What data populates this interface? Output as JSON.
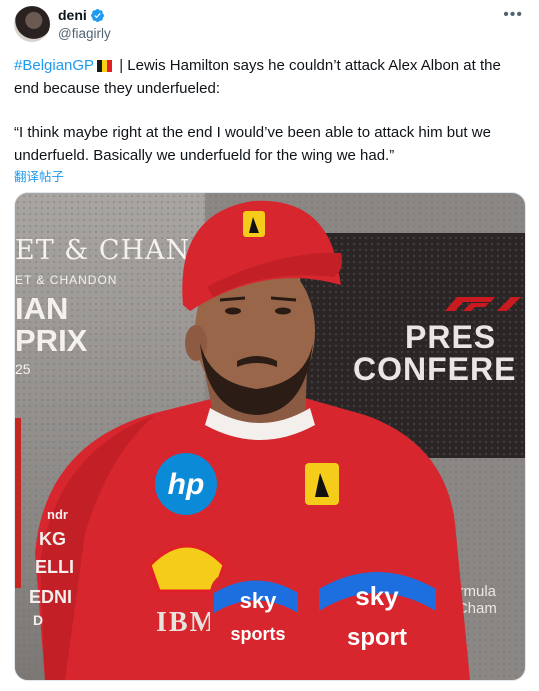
{
  "author": {
    "display_name": "deni",
    "handle": "@fiagirly",
    "verified": true
  },
  "tweet": {
    "hashtag": "#BelgianGP",
    "line1_rest": " | Lewis Hamilton says he couldn’t attack Alex Albon at the end because they underfueled:",
    "quote": "“I think maybe right at the end I would’ve been able to attack him but we underfueld. Basically we underfueld for the wing we had.”",
    "translate_label": "翻译帖子",
    "flag_colors": [
      "#1a1a1a",
      "#f7d117",
      "#e21f26"
    ]
  },
  "media": {
    "backdrop_left": [
      "ET & CHAN",
      "ET & CHANDON",
      "IAN",
      "PRIX",
      "25"
    ],
    "press_conference": [
      "PRES",
      "CONFERE"
    ],
    "backdrop_f1_text": [
      "Formula",
      "ld Cham"
    ],
    "shirt_left_text": [
      "ndr",
      "KG",
      "ELLI",
      "EDNI",
      "D"
    ],
    "sponsor_hp": "hp",
    "sponsor_ibm": "IBM",
    "mic1": [
      "sky",
      "sports"
    ],
    "mic2": [
      "sky",
      "sport"
    ],
    "colors": {
      "ferrari_red": "#d7262d",
      "sky_blue": "#1d6fe0"
    }
  },
  "icons": {
    "more": "more-horizontal-icon",
    "verified": "verified-badge-icon"
  }
}
